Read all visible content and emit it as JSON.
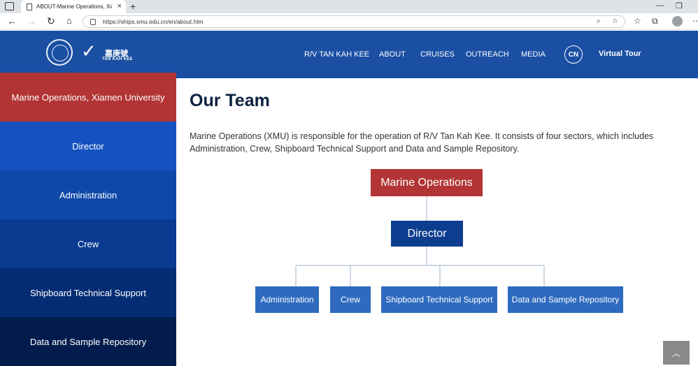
{
  "browser": {
    "tab_title": "ABOUT-Marine Operations, Xiam",
    "url": "https://ships.xmu.edu.cn/en/about.htm"
  },
  "header": {
    "logo_cn": "嘉庚號",
    "logo_en": "TAN KAH KEE",
    "menu": [
      "R/V TAN KAH KEE",
      "ABOUT",
      "CRUISES",
      "OUTREACH",
      "MEDIA"
    ],
    "lang_button": "CN",
    "virtual_tour": "Virtual Tour"
  },
  "sidebar": {
    "items": [
      {
        "label": "Marine Operations, Xiamen University",
        "color": "#b23434"
      },
      {
        "label": "Director",
        "color": "#1552c0"
      },
      {
        "label": "Administration",
        "color": "#0f48a8"
      },
      {
        "label": "Crew",
        "color": "#0a3b91"
      },
      {
        "label": "Shipboard Technical Support",
        "color": "#052d76"
      },
      {
        "label": "Data and Sample Repository",
        "color": "#021c4d"
      }
    ]
  },
  "main": {
    "title": "Our Team",
    "intro": "Marine Operations (XMU) is responsible for the operation of R/V Tan Kah Kee. It consists of four sectors, which includes Administration, Crew, Shipboard Technical Support and Data and Sample Repository."
  },
  "org_chart": {
    "root": "Marine Operations",
    "director": "Director",
    "sectors": [
      "Administration",
      "Crew",
      "Shipboard Technical Support",
      "Data and Sample Repository"
    ],
    "root_color": "#b23434",
    "director_color": "#0d3d8f",
    "sector_color": "#2e6bbf"
  },
  "back_to_top": "︿"
}
